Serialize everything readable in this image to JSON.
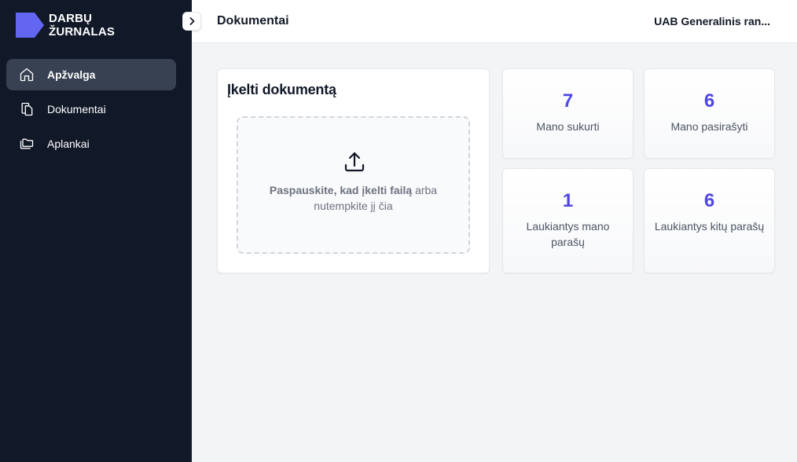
{
  "brand": {
    "line1": "DARBŲ",
    "line2": "ŽURNALAS",
    "color": "#6366f1"
  },
  "sidebar": {
    "items": [
      {
        "label": "Apžvalga",
        "icon": "home-icon",
        "active": true
      },
      {
        "label": "Dokumentai",
        "icon": "documents-icon",
        "active": false
      },
      {
        "label": "Aplankai",
        "icon": "folders-icon",
        "active": false
      }
    ]
  },
  "header": {
    "title": "Dokumentai",
    "company": "UAB Generalinis ran..."
  },
  "upload": {
    "title": "Įkelti dokumentą",
    "cta_bold": "Paspauskite, kad įkelti failą",
    "cta_rest": " arba nutempkite jį čia"
  },
  "stats": [
    {
      "value": "7",
      "label": "Mano sukurti"
    },
    {
      "value": "6",
      "label": "Mano pasirašyti"
    },
    {
      "value": "1",
      "label": "Laukiantys mano parašų"
    },
    {
      "value": "6",
      "label": "Laukiantys kitų parašų"
    }
  ],
  "colors": {
    "sidebar_bg": "#111827",
    "accent": "#4f46e5",
    "active_item": "#374151"
  }
}
